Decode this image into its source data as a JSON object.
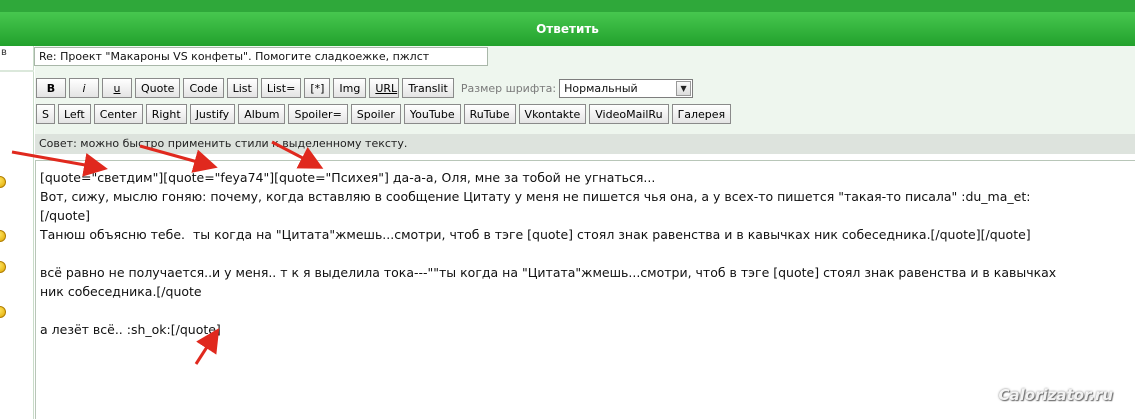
{
  "header": {
    "title": "Ответить"
  },
  "left": {
    "char": "в"
  },
  "subject": {
    "value": "Re: Проект \"Макароны VS конфеты\". Помогите сладкоежке, пжлст"
  },
  "toolbar": {
    "row1": [
      {
        "name": "bold-button",
        "label": "B",
        "cls": "bold"
      },
      {
        "name": "italic-button",
        "label": "i",
        "cls": "italic"
      },
      {
        "name": "underline-button",
        "label": "u",
        "cls": "underline"
      },
      {
        "name": "quote-button",
        "label": "Quote"
      },
      {
        "name": "code-button",
        "label": "Code"
      },
      {
        "name": "list-button",
        "label": "List"
      },
      {
        "name": "list-eq-button",
        "label": "List="
      },
      {
        "name": "list-item-button",
        "label": "[*]"
      },
      {
        "name": "img-button",
        "label": "Img"
      },
      {
        "name": "url-button",
        "label": "URL",
        "cls": "underline"
      },
      {
        "name": "translit-button",
        "label": "Translit"
      }
    ],
    "font_size_label": "Размер шрифта:",
    "font_size_value": "Нормальный",
    "row2": [
      {
        "name": "strike-button",
        "label": "S"
      },
      {
        "name": "left-button",
        "label": "Left"
      },
      {
        "name": "center-button",
        "label": "Center"
      },
      {
        "name": "right-button",
        "label": "Right"
      },
      {
        "name": "justify-button",
        "label": "Justify"
      },
      {
        "name": "album-button",
        "label": "Album"
      },
      {
        "name": "spoiler-eq-button",
        "label": "Spoiler="
      },
      {
        "name": "spoiler-button",
        "label": "Spoiler"
      },
      {
        "name": "youtube-button",
        "label": "YouTube"
      },
      {
        "name": "rutube-button",
        "label": "RuTube"
      },
      {
        "name": "vkontakte-button",
        "label": "Vkontakte"
      },
      {
        "name": "videomailru-button",
        "label": "VideoMailRu"
      },
      {
        "name": "gallery-button",
        "label": "Галерея"
      }
    ]
  },
  "tip": "Совет: можно быстро применить стили к выделенному тексту.",
  "editor": {
    "lines": [
      "[quote=\"светдим\"][quote=\"feya74\"][quote=\"Психея\"] да-а-а, Оля, мне за тобой не угнаться...",
      "Вот, сижу, мыслю гоняю: почему, когда вставляю в сообщение Цитату у меня не пишется чья она, а у всех-то пишется \"такая-то писала\" :du_ma_et:",
      "[/quote]",
      "Танюш объясню тебе.  ты когда на \"Цитата\"жмешь...смотри, чтоб в тэге [quote] стоял знак равенства и в кавычках ник собеседника.[/quote][/quote]",
      "",
      "всё равно не получается..и у меня.. т к я выделила тока---\"\"ты когда на \"Цитата\"жмешь...смотри, чтоб в тэге [quote] стоял знак равенства и в кавычках",
      "ник собеседника.[/quote",
      "",
      "а лезёт всё.. :sh_ok:[/quote]"
    ]
  },
  "watermark": "Calorizator.ru",
  "colors": {
    "header_green": "#2fa83a",
    "panel_bg": "#eef6ee",
    "arrow_red": "#e0291e"
  }
}
